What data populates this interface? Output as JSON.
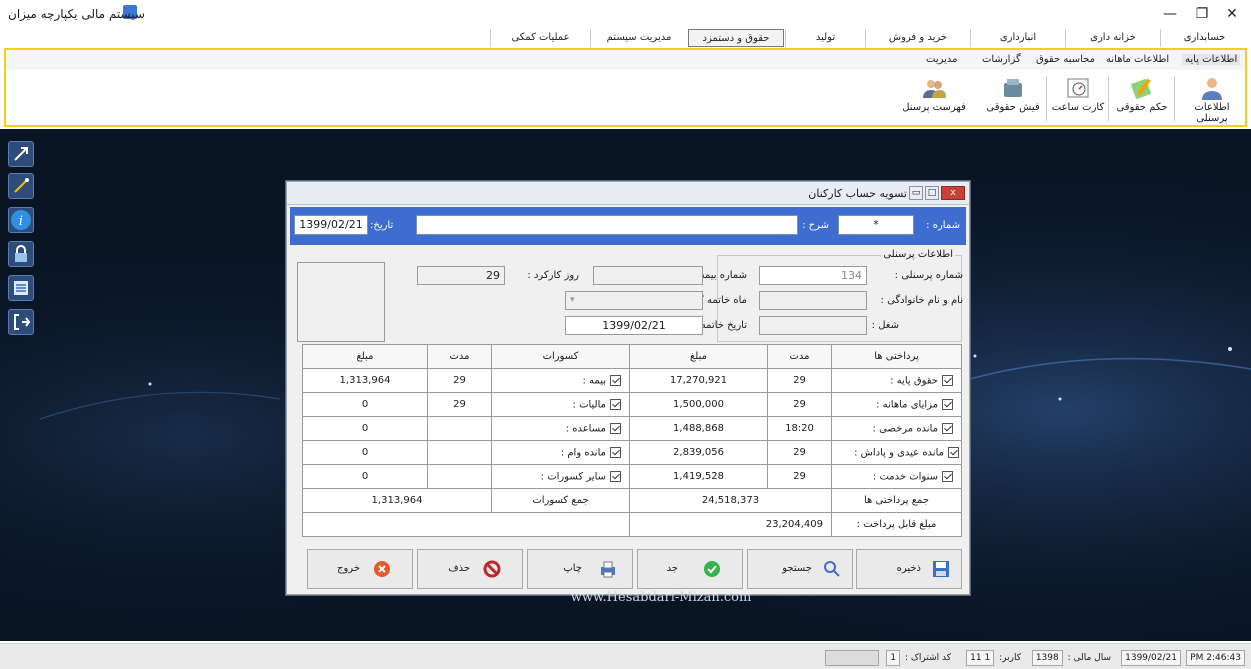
{
  "window": {
    "title": "سیستم مالی یکپارچه میزان",
    "controls": {
      "minimize": "—",
      "maximize": "❐",
      "close": "✕"
    }
  },
  "menu": [
    "حسابداری",
    "خزانه داری",
    "انبارداری",
    "خرید و فروش",
    "تولید",
    "حقوق و دستمزد",
    "مدیریت سیستم",
    "عملیات کمکی"
  ],
  "ribbon": {
    "sub_tabs": [
      "اطلاعات پایه",
      "اطلاعات ماهانه",
      "محاسبه حقوق",
      "گزارشات",
      "مدیریت"
    ],
    "buttons": [
      "اطلاعات پرسنلی",
      "حکم حقوقی",
      "کارت ساعت",
      "فیش حقوقی",
      "فهرست پرسنل"
    ]
  },
  "dialog": {
    "title": "تسویه حساب کارکنان",
    "title_buttons": {
      "close": "x",
      "maximize": "□",
      "minimize": "▭"
    },
    "header": {
      "number_label": "شماره :",
      "number_value": "*",
      "desc_label": "شرح :",
      "desc_value": "",
      "date_label": "تاریخ:",
      "date_value": "1399/02/21"
    },
    "personnel_group_title": "اطلاعات پرسنلی",
    "fields": {
      "personnel_no_label": "شماره پرسنلی :",
      "personnel_no": "134",
      "name_label": "نام و نام خانوادگی :",
      "name": "",
      "job_label": "شغل :",
      "job": "",
      "insurance_no_label": "شماره بیمه :",
      "insurance_no": "",
      "end_month_label": "ماه خاتمه کار :",
      "end_month": "",
      "end_date_label": "تاریخ خاتمه کار :",
      "end_date": "1399/02/21",
      "work_days_label": "روز کارکرد :",
      "work_days": "29"
    },
    "table": {
      "headers": {
        "payments": "پرداختی ها",
        "duration": "مدت",
        "amount": "مبلغ",
        "deductions": "کسورات",
        "ded_duration": "مدت",
        "ded_amount": "مبلغ"
      },
      "rows": [
        {
          "pay": "حقوق پایه :",
          "pdur": "29",
          "pamt": "17,270,921",
          "ded": "بیمه :",
          "ddur": "29",
          "damt": "1,313,964"
        },
        {
          "pay": "مزایای ماهانه :",
          "pdur": "29",
          "pamt": "1,500,000",
          "ded": "مالیات :",
          "ddur": "29",
          "damt": "0"
        },
        {
          "pay": "مانده مرخصی :",
          "pdur": "18:20",
          "pamt": "1,488,868",
          "ded": "مساعده :",
          "ddur": "",
          "damt": "0"
        },
        {
          "pay": "مانده عیدی و پاداش :",
          "pdur": "29",
          "pamt": "2,839,056",
          "ded": "مانده وام :",
          "ddur": "",
          "damt": "0"
        },
        {
          "pay": "سنوات خدمت :",
          "pdur": "29",
          "pamt": "1,419,528",
          "ded": "سایر کسورات :",
          "ddur": "",
          "damt": "0"
        }
      ],
      "total_pay_label": "جمع پرداختی ها",
      "total_pay": "24,518,373",
      "total_ded_label": "جمع کسورات",
      "total_ded": "1,313,964",
      "payable_label": "مبلغ قابل پرداخت :",
      "payable": "23,204,409"
    },
    "buttons": {
      "save": "ذخیره",
      "search": "جستجو",
      "new": "جد",
      "print": "چاپ",
      "delete": "حذف",
      "exit": "خروج"
    }
  },
  "watermark": "www.Hesabdari-Mizan.com",
  "status": {
    "time": "PM 2:46:43",
    "date": "1399/02/21",
    "fiscal_year_label": "سال مالی :",
    "fiscal_year": "1398",
    "user_label": "کاربر:",
    "user": "1 11",
    "subscription_label": "کد اشتراک :",
    "subscription": "1"
  },
  "colors": {
    "accent": "#3f6dcf",
    "ribbon_border": "#f2d20f",
    "desktop": "#0a1524"
  }
}
